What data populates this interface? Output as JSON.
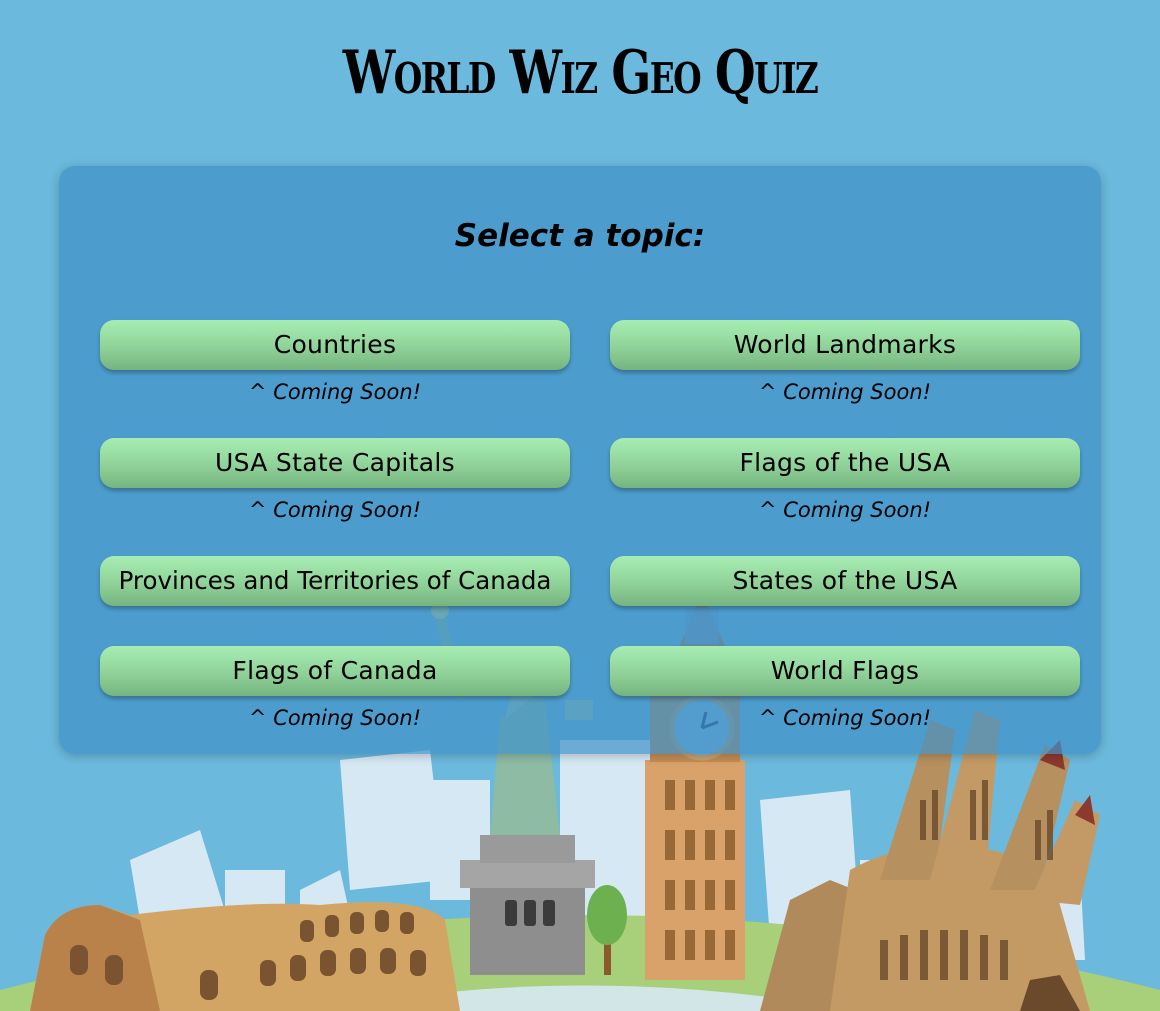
{
  "title": "World Wiz Geo Quiz",
  "subtitle": "Select a topic:",
  "topics": [
    {
      "label": "Countries",
      "note": "^ Coming Soon!"
    },
    {
      "label": "World Landmarks",
      "note": "^ Coming Soon!"
    },
    {
      "label": "USA State Capitals",
      "note": "^ Coming Soon!"
    },
    {
      "label": "Flags of the USA",
      "note": "^ Coming Soon!"
    },
    {
      "label": "Provinces and Territories of Canada"
    },
    {
      "label": "States of the USA"
    },
    {
      "label": "Flags of Canada",
      "note": "^ Coming Soon!"
    },
    {
      "label": "World Flags",
      "note": "^ Coming Soon!"
    }
  ],
  "colors": {
    "background": "#6bb9dc",
    "panel": "#3f91c8",
    "button_top": "#a7edb2",
    "button_bottom": "#76b47f"
  }
}
